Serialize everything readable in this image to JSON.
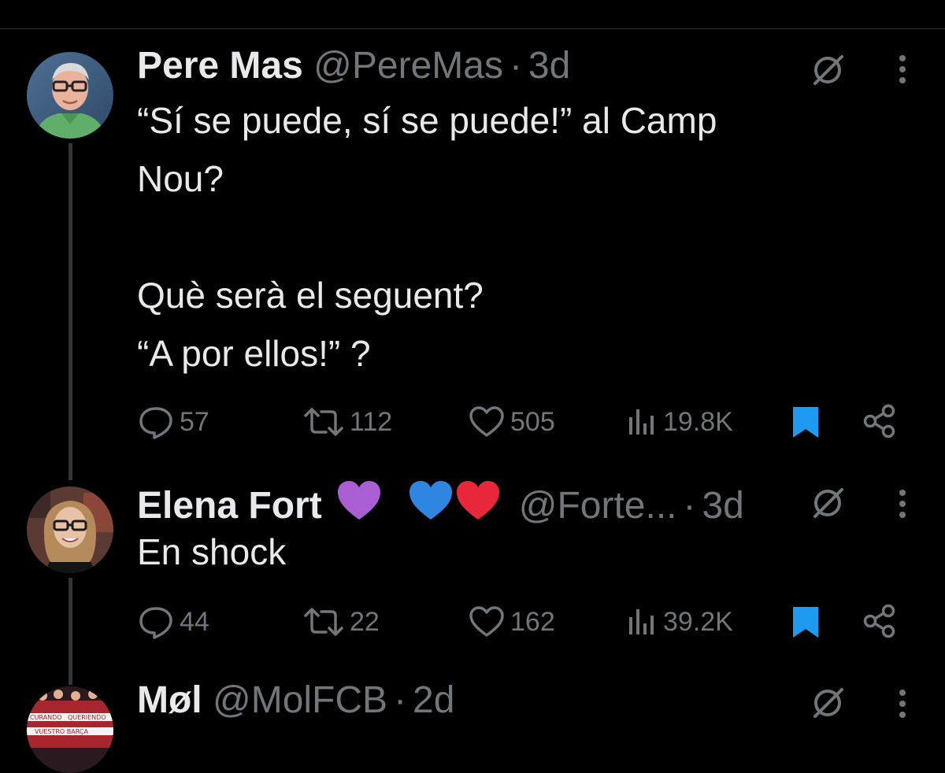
{
  "tweets": [
    {
      "name": "Pere Mas",
      "handle": "@PereMas",
      "separator": "·",
      "time": "3d",
      "text": "“Sí se puede, sí se puede!” al Camp\nNou?\n\nQuè serà el seguent?\n“A por ellos!” ?",
      "replies": "57",
      "reposts": "112",
      "likes": "505",
      "views": "19.8K",
      "bookmarked": true,
      "avatar_icon": "avatar-man-glasses-green-shirt"
    },
    {
      "name": "Elena Fort",
      "emojis": [
        "purple-heart",
        "blue-heart",
        "red-heart"
      ],
      "handle": "@Forte...",
      "separator": "·",
      "time": "3d",
      "text": "En shock",
      "replies": "44",
      "reposts": "22",
      "likes": "162",
      "views": "39.2K",
      "bookmarked": true,
      "avatar_icon": "avatar-woman-glasses"
    },
    {
      "name": "Møl",
      "handle": "@MolFCB",
      "separator": "·",
      "time": "2d",
      "avatar_icon": "avatar-barca-banner",
      "avatar_text": [
        "CURANDO",
        "QUERIENDO",
        "VUESTRO BARÇA"
      ]
    }
  ],
  "colors": {
    "background": "#000000",
    "text": "#e7e9ea",
    "muted": "#71767b",
    "bookmark_blue": "#1d9bf0",
    "divider": "#2f3336"
  }
}
